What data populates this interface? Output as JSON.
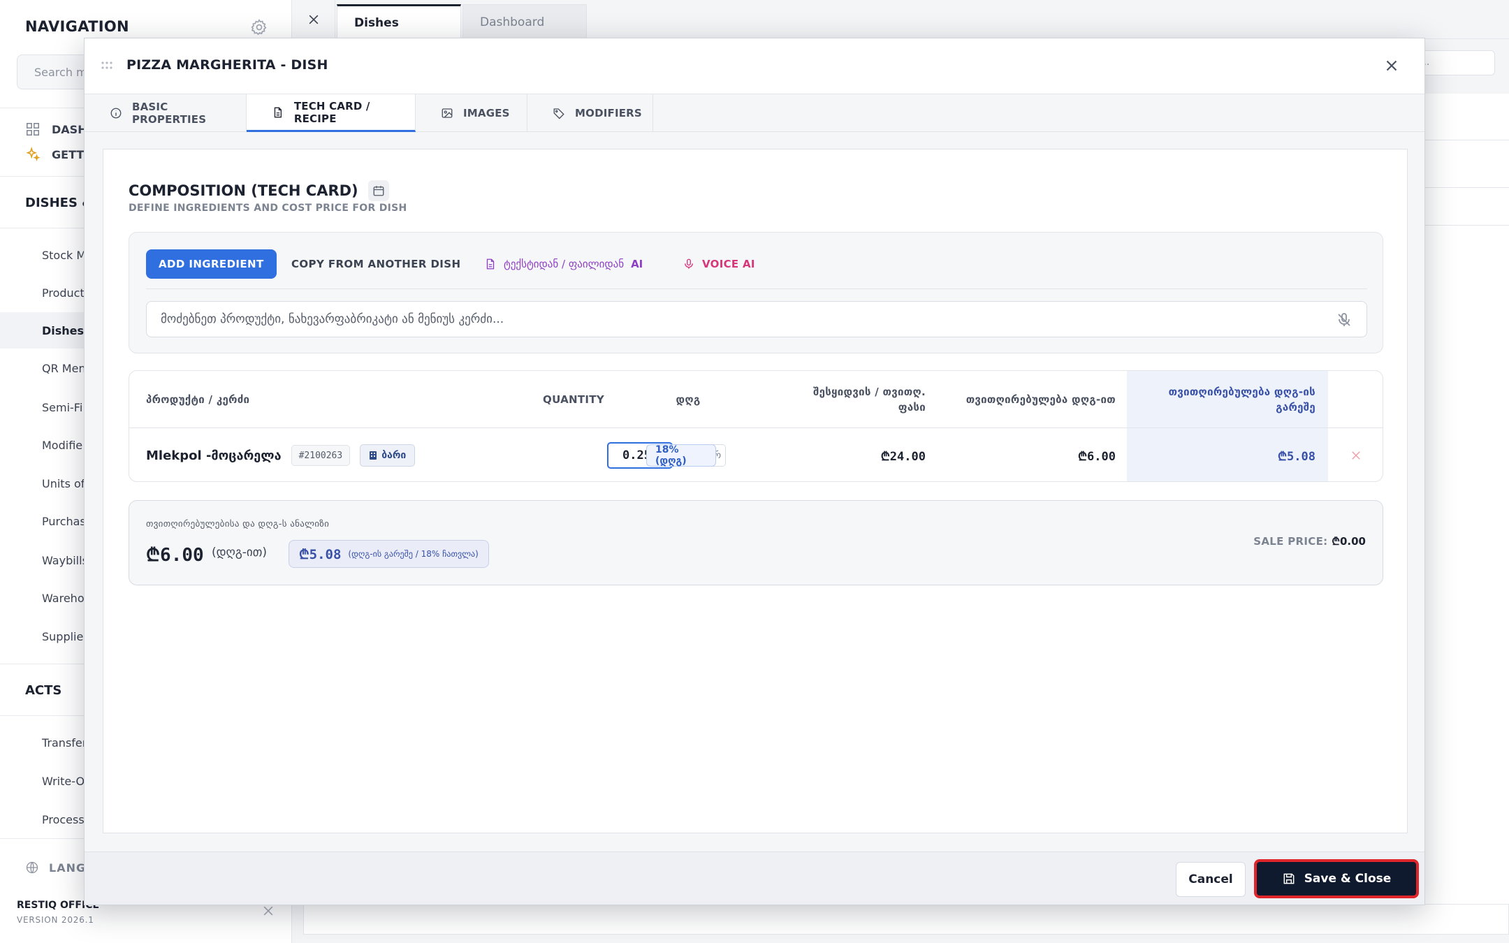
{
  "sidebar": {
    "title": "NAVIGATION",
    "search_placeholder": "Search m",
    "top_items": [
      {
        "label": "DASH",
        "icon": "grid-icon"
      },
      {
        "label": "GETTI",
        "icon": "sparkles-icon"
      }
    ],
    "section_dishes": "DISHES &",
    "items": [
      "Stock M",
      "Product",
      "Dishes",
      "QR Men",
      "Semi-Fi",
      "Modifie",
      "Units of",
      "Purchas",
      "Waybills",
      "Wareho",
      "Supplier"
    ],
    "active_item": "Dishes",
    "section_acts": "ACTS",
    "acts_items": [
      "Transfer",
      "Write-O",
      "Processi"
    ],
    "language_label": "LANGU",
    "brand": "RESTIQ OFFICE",
    "version": "VERSION 2026.1"
  },
  "topbar": {
    "tabs": [
      {
        "label": "Dishes",
        "active": true
      },
      {
        "label": "Dashboard",
        "active": false
      }
    ],
    "bg_search_placeholder": "..."
  },
  "modal": {
    "title": "PIZZA MARGHERITA - DISH",
    "tabs": [
      {
        "label": "BASIC PROPERTIES",
        "icon": "info-icon"
      },
      {
        "label": "TECH CARD / RECIPE",
        "icon": "document-icon",
        "active": true
      },
      {
        "label": "IMAGES",
        "icon": "image-icon"
      },
      {
        "label": "MODIFIERS",
        "icon": "tag-icon"
      }
    ],
    "section_title": "COMPOSITION (TECH CARD)",
    "section_subtitle": "DEFINE INGREDIENTS AND COST PRICE FOR DISH",
    "toolbar": {
      "add_label": "ADD INGREDIENT",
      "copy_label": "COPY FROM ANOTHER DISH",
      "ai_text_label": "ტექსტიდან / ფაილიდან",
      "ai_suffix": "AI",
      "voice_label": "VOICE AI",
      "search_placeholder": "მოძებნეთ პროდუქტი, ნახევარფაბრიკატი ან მენიუს კერძი..."
    },
    "table": {
      "headers": {
        "product": "პროდუქტი / კერძი",
        "quantity": "QUANTITY",
        "vat": "დღგ",
        "purchase_line1": "შესყიდვის / თვითღ.",
        "purchase_line2": "ფასი",
        "cost_with_vat": "თვითღირებულება დღგ-ით",
        "cost_without_vat_line1": "თვითღირებულება დღგ-ის",
        "cost_without_vat_line2": "გარეშე"
      },
      "rows": [
        {
          "product": "Mlekpol -მოცარელა",
          "code": "#2100263",
          "warehouse": "ბარი",
          "quantity": "0.25",
          "unit_selected": "კ",
          "unit_other": "გრ",
          "vat": "18% (დღგ)",
          "purchase_price": "₾24.00",
          "cost_with_vat": "₾6.00",
          "cost_without_vat": "₾5.08"
        }
      ]
    },
    "summary": {
      "label": "თვითღირებულებისა და დღგ-ს ანალიზი",
      "total_with_vat": "₾6.00",
      "total_with_vat_note": "(დღგ-ით)",
      "total_without_vat": "₾5.08",
      "total_without_vat_note": "(დღგ-ის გარეშე / 18% ჩათვლა)",
      "sale_price_label": "SALE PRICE:",
      "sale_price_value": "₾0.00"
    },
    "footer": {
      "cancel_label": "Cancel",
      "save_label": "Save & Close"
    }
  },
  "colors": {
    "accent": "#2f6fe0",
    "dark": "#0f1a2e",
    "highlight_red": "#e0262b",
    "ai_purple": "#8e3fc4",
    "voice_pink": "#d6367a"
  }
}
